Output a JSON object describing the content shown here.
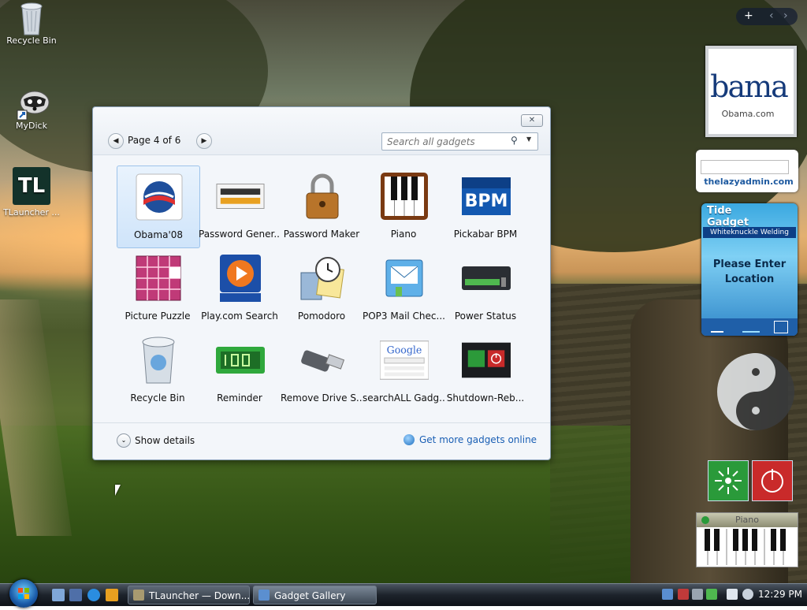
{
  "desktop": {
    "icons": [
      {
        "label": "Recycle Bin",
        "icon": "recycle-bin-icon"
      },
      {
        "label": "MyDick",
        "icon": "raccoon-shortcut-icon"
      },
      {
        "label": "TLauncher ...",
        "icon": "tlauncher-icon",
        "icon_text": "TL"
      }
    ]
  },
  "gallery": {
    "close_label": "✕",
    "prev_label": "◀",
    "next_label": "▶",
    "page_label": "Page 4 of 6",
    "search_placeholder": "Search all gadgets",
    "search_icon": "⚲",
    "search_dropdown": "▼",
    "gadgets": [
      {
        "label": "Obama'08",
        "icon": "obama-logo-icon",
        "selected": true
      },
      {
        "label": "Password Gener...",
        "icon": "password-generator-icon"
      },
      {
        "label": "Password Maker",
        "icon": "padlock-icon"
      },
      {
        "label": "Piano",
        "icon": "piano-keys-icon"
      },
      {
        "label": "Pickabar BPM",
        "icon": "pickabar-bpm-icon"
      },
      {
        "label": "Picture Puzzle",
        "icon": "picture-puzzle-icon"
      },
      {
        "label": "Play.com Search",
        "icon": "play-com-icon"
      },
      {
        "label": "Pomodoro",
        "icon": "clock-calculator-icon"
      },
      {
        "label": "POP3 Mail Chec...",
        "icon": "mail-icon"
      },
      {
        "label": "Power Status",
        "icon": "battery-status-icon"
      },
      {
        "label": "Recycle Bin",
        "icon": "recycle-bin-icon"
      },
      {
        "label": "Reminder",
        "icon": "digital-clock-icon"
      },
      {
        "label": "Remove Drive S...",
        "icon": "usb-drive-icon"
      },
      {
        "label": "searchALL Gadg...",
        "icon": "google-search-icon"
      },
      {
        "label": "Shutdown-Reb...",
        "icon": "shutdown-icon"
      }
    ],
    "details_expand": "⌄",
    "show_details": "Show details",
    "more_gadgets": "Get more gadgets online"
  },
  "sidebar": {
    "add_label": "+",
    "prev_label": "‹",
    "next_label": "›",
    "obama": {
      "big": "bama",
      "small": "Obama.com"
    },
    "lazyadmin": {
      "text": "thelazyadmin.com"
    },
    "tide": {
      "title_1": "Tide",
      "title_2": "Gadget",
      "subtitle": "Whiteknuckle Welding",
      "message": "Please Enter Location"
    },
    "piano": {
      "label": "Piano"
    }
  },
  "taskbar": {
    "tasks": [
      {
        "label": "TLauncher — Down..."
      },
      {
        "label": "Gadget Gallery",
        "active": true
      }
    ],
    "clock": "12:29 PM"
  },
  "colors": {
    "accent": "#1a5fb4",
    "selection": "#cfe4fa",
    "tide_blue": "#3aa8e0"
  }
}
